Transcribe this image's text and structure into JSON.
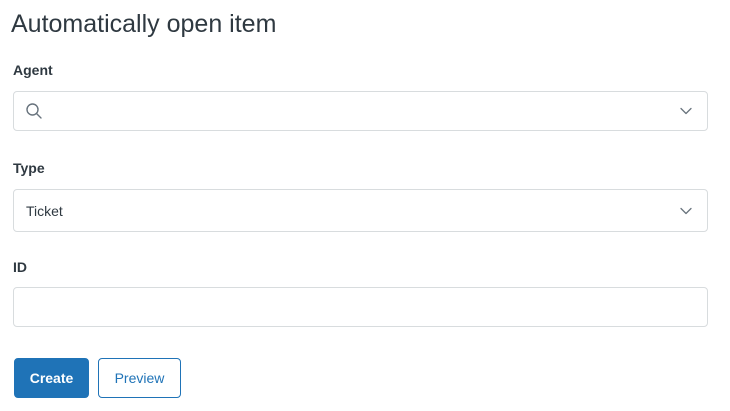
{
  "page": {
    "title": "Automatically open item"
  },
  "form": {
    "agent": {
      "label": "Agent",
      "value": "",
      "icon": "search-icon"
    },
    "type": {
      "label": "Type",
      "selected": "Ticket"
    },
    "id": {
      "label": "ID",
      "value": ""
    }
  },
  "actions": {
    "create_label": "Create",
    "preview_label": "Preview"
  },
  "colors": {
    "primary": "#1f73b7",
    "border": "#d8dcde",
    "text": "#2f3941",
    "icon": "#68737d"
  }
}
